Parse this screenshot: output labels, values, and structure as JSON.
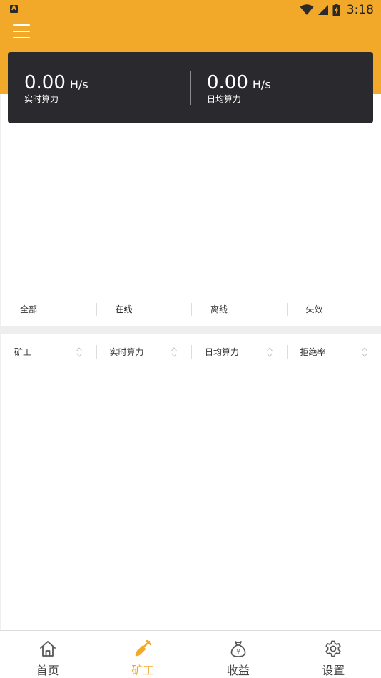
{
  "status_bar": {
    "notification_letter": "A",
    "time": "3:18"
  },
  "stats": {
    "realtime": {
      "value": "0.00",
      "unit": "H/s",
      "label": "实时算力"
    },
    "daily": {
      "value": "0.00",
      "unit": "H/s",
      "label": "日均算力"
    }
  },
  "filter_tabs": [
    {
      "label": "全部"
    },
    {
      "label": "在线"
    },
    {
      "label": "离线"
    },
    {
      "label": "失效"
    }
  ],
  "table": {
    "columns": [
      {
        "label": "矿工"
      },
      {
        "label": "实时算力"
      },
      {
        "label": "日均算力"
      },
      {
        "label": "拒绝率"
      }
    ]
  },
  "bottom_nav": [
    {
      "label": "首页",
      "icon": "home-icon"
    },
    {
      "label": "矿工",
      "icon": "shovel-icon"
    },
    {
      "label": "收益",
      "icon": "money-bag-icon"
    },
    {
      "label": "设置",
      "icon": "gear-icon"
    }
  ],
  "colors": {
    "accent": "#F2A929",
    "card": "#2a2a2e"
  }
}
